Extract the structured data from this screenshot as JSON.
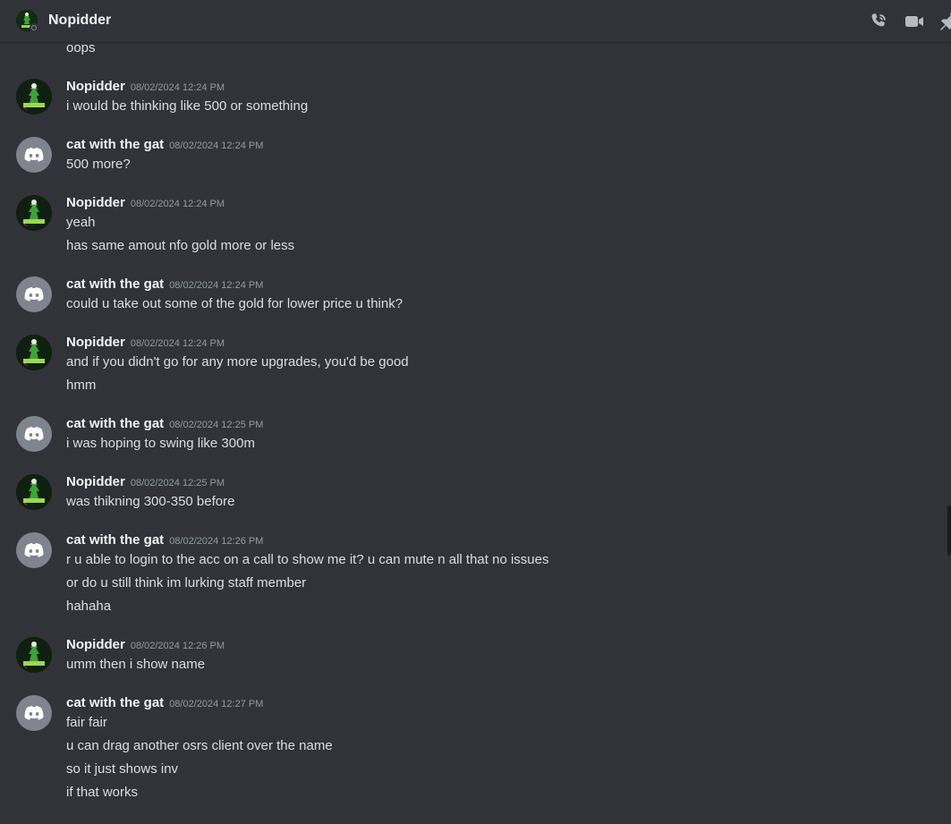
{
  "header": {
    "title": "Nopidder"
  },
  "first_line": "oops",
  "groups": [
    {
      "author": "Nopidder",
      "timestamp": "08/02/2024 12:24 PM",
      "avatar": "nopidder",
      "lines": [
        "i would be thinking like 500 or something"
      ]
    },
    {
      "author": "cat with the gat",
      "timestamp": "08/02/2024 12:24 PM",
      "avatar": "discord",
      "lines": [
        "500 more?"
      ]
    },
    {
      "author": "Nopidder",
      "timestamp": "08/02/2024 12:24 PM",
      "avatar": "nopidder",
      "lines": [
        "yeah",
        "has same amout nfo gold more or less"
      ]
    },
    {
      "author": "cat with the gat",
      "timestamp": "08/02/2024 12:24 PM",
      "avatar": "discord",
      "lines": [
        "could u take out some of the gold for lower price u think?"
      ]
    },
    {
      "author": "Nopidder",
      "timestamp": "08/02/2024 12:24 PM",
      "avatar": "nopidder",
      "lines": [
        "and if you didn't go for any more upgrades, you'd be good",
        "hmm"
      ]
    },
    {
      "author": "cat with the gat",
      "timestamp": "08/02/2024 12:25 PM",
      "avatar": "discord",
      "lines": [
        "i was hoping to swing like 300m"
      ]
    },
    {
      "author": "Nopidder",
      "timestamp": "08/02/2024 12:25 PM",
      "avatar": "nopidder",
      "lines": [
        "was thikning 300-350 before"
      ]
    },
    {
      "author": "cat with the gat",
      "timestamp": "08/02/2024 12:26 PM",
      "avatar": "discord",
      "lines": [
        "r u able to login to the acc on a call to show me it? u can mute n all that no issues",
        "or do u still think im lurking staff member",
        "hahaha"
      ]
    },
    {
      "author": "Nopidder",
      "timestamp": "08/02/2024 12:26 PM",
      "avatar": "nopidder",
      "lines": [
        "umm then i show name"
      ]
    },
    {
      "author": "cat with the gat",
      "timestamp": "08/02/2024 12:27 PM",
      "avatar": "discord",
      "lines": [
        "fair fair",
        "u can drag another osrs client over the name",
        "so it just shows inv",
        "if that works"
      ]
    }
  ],
  "icons": {
    "call": "phone-call-icon",
    "video": "video-camera-icon",
    "pin": "pin-icon",
    "discord": "discord-logo-icon"
  },
  "colors": {
    "background": "#313338",
    "author": "#f2f3f5",
    "text": "#dbdee1",
    "timestamp": "#949ba4",
    "discord_avatar": "#80848e"
  }
}
